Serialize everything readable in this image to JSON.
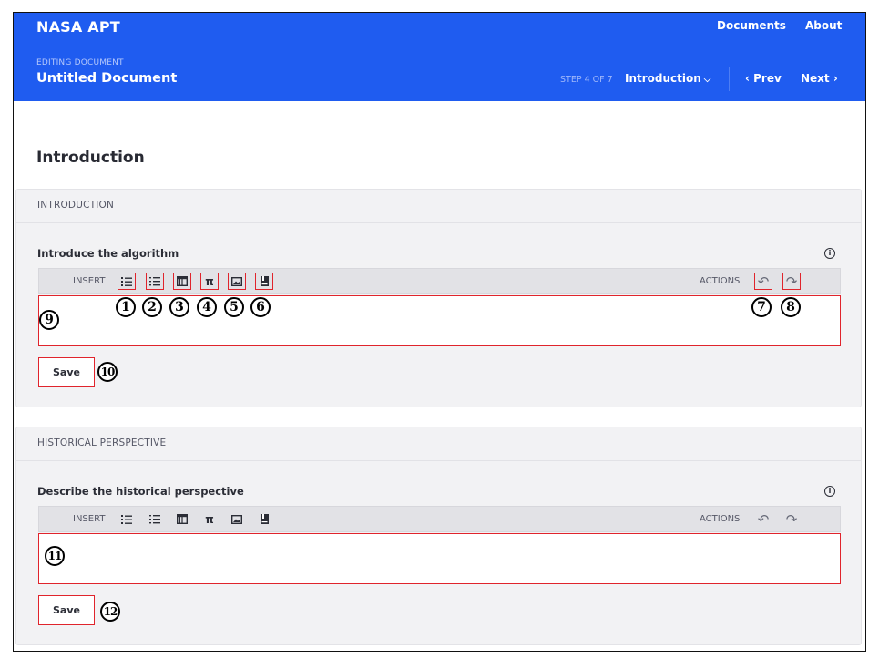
{
  "header": {
    "app_title": "NASA APT",
    "nav": {
      "documents": "Documents",
      "about": "About"
    },
    "editing_label": "EDITING DOCUMENT",
    "document_title": "Untitled Document",
    "step_label": "STEP 4 OF 7",
    "step_select": "Introduction",
    "prev": "‹ Prev",
    "next": "Next ›"
  },
  "page_title": "Introduction",
  "sections": [
    {
      "heading": "INTRODUCTION",
      "field_label": "Introduce the algorithm",
      "insert_label": "INSERT",
      "actions_label": "ACTIONS",
      "save_label": "Save",
      "markers": [
        "1",
        "2",
        "3",
        "4",
        "5",
        "6",
        "7",
        "8",
        "9",
        "10"
      ]
    },
    {
      "heading": "HISTORICAL PERSPECTIVE",
      "field_label": "Describe the historical perspective",
      "insert_label": "INSERT",
      "actions_label": "ACTIONS",
      "save_label": "Save",
      "markers": [
        "11",
        "12"
      ]
    }
  ],
  "icons": {
    "info": "info-icon",
    "toolbar": [
      "bulleted-list-icon",
      "numbered-list-icon",
      "table-icon",
      "pi-equation-icon",
      "image-icon",
      "reference-icon"
    ],
    "actions": [
      "undo-icon",
      "redo-icon"
    ]
  },
  "colors": {
    "header": "#1f5cf0",
    "highlight": "#e0242c"
  }
}
